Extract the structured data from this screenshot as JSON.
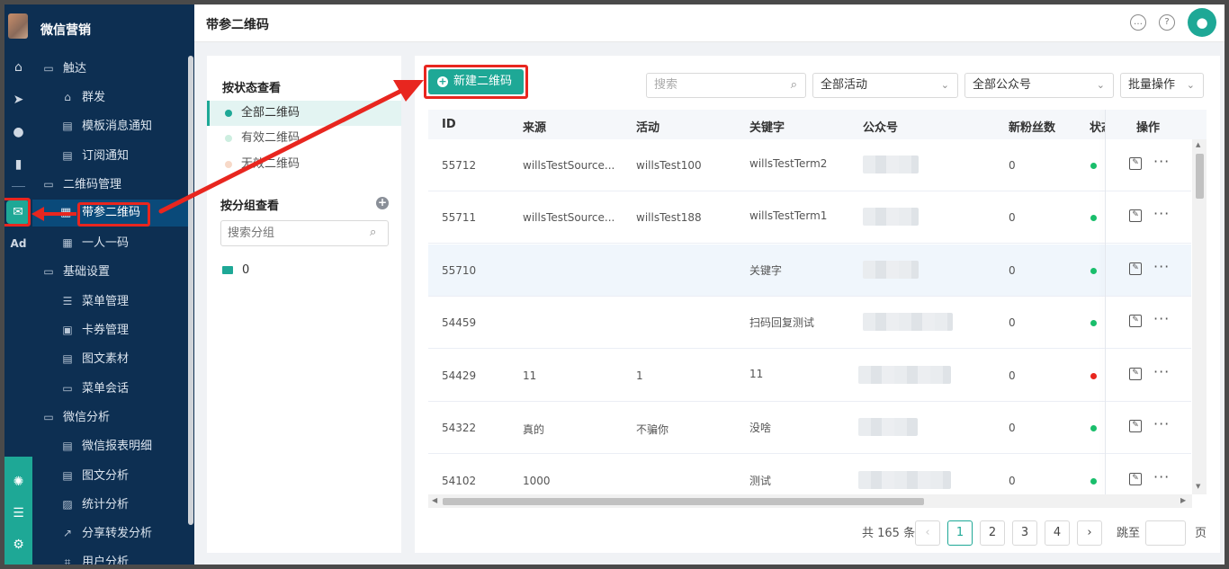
{
  "sidebar": {
    "brand": "微信营销",
    "items": [
      {
        "label": "触达"
      },
      {
        "label": "群发"
      },
      {
        "label": "模板消息通知"
      },
      {
        "label": "订阅通知"
      },
      {
        "label": "二维码管理"
      },
      {
        "label": "带参二维码"
      },
      {
        "label": "一人一码"
      },
      {
        "label": "基础设置"
      },
      {
        "label": "菜单管理"
      },
      {
        "label": "卡券管理"
      },
      {
        "label": "图文素材"
      },
      {
        "label": "菜单会话"
      },
      {
        "label": "微信分析"
      },
      {
        "label": "微信报表明细"
      },
      {
        "label": "图文分析"
      },
      {
        "label": "统计分析"
      },
      {
        "label": "分享转发分析"
      },
      {
        "label": "用户分析"
      }
    ]
  },
  "rail": {
    "ad_label": "Ad"
  },
  "header": {
    "title": "带参二维码"
  },
  "filters": {
    "status_title": "按状态查看",
    "status_items": [
      {
        "label": "全部二维码",
        "color": "#1ea896"
      },
      {
        "label": "有效二维码",
        "color": "#cdeee0"
      },
      {
        "label": "无效二维码",
        "color": "#f7d9c8"
      }
    ],
    "group_title": "按分组查看",
    "group_search_placeholder": "搜索分组",
    "groups": [
      {
        "label": "0"
      }
    ]
  },
  "toolbar": {
    "new_label": "新建二维码",
    "search_placeholder": "搜索",
    "activity_select": "全部活动",
    "account_select": "全部公众号",
    "batch_label": "批量操作"
  },
  "table": {
    "columns": [
      "ID",
      "来源",
      "活动",
      "关键字",
      "公众号",
      "新粉丝数",
      "状态",
      "操作"
    ],
    "rows": [
      {
        "id": "55712",
        "source": "willsTestSource...",
        "activity": "willsTest100",
        "keyword": "willsTestTerm2",
        "fans": "0",
        "status": "valid"
      },
      {
        "id": "55711",
        "source": "willsTestSource...",
        "activity": "willsTest188",
        "keyword": "willsTestTerm1",
        "fans": "0",
        "status": "valid"
      },
      {
        "id": "55710",
        "source": "",
        "activity": "",
        "keyword": "关键字",
        "fans": "0",
        "status": "valid"
      },
      {
        "id": "54459",
        "source": "",
        "activity": "",
        "keyword": "扫码回复测试",
        "fans": "0",
        "status": "valid"
      },
      {
        "id": "54429",
        "source": "11",
        "activity": "1",
        "keyword": "11",
        "fans": "0",
        "status": "invalid"
      },
      {
        "id": "54322",
        "source": "真的",
        "activity": "不骗你",
        "keyword": "没啥",
        "fans": "0",
        "status": "valid"
      },
      {
        "id": "54102",
        "source": "1000",
        "activity": "",
        "keyword": "测试",
        "fans": "0",
        "status": "valid"
      }
    ]
  },
  "status_colors": {
    "valid": "#19be6b",
    "invalid": "#e8261f"
  },
  "pagination": {
    "total_label": "共 165 条",
    "pages": [
      "1",
      "2",
      "3",
      "4"
    ],
    "current": "1",
    "jump_label": "跳至",
    "page_unit": "页"
  }
}
